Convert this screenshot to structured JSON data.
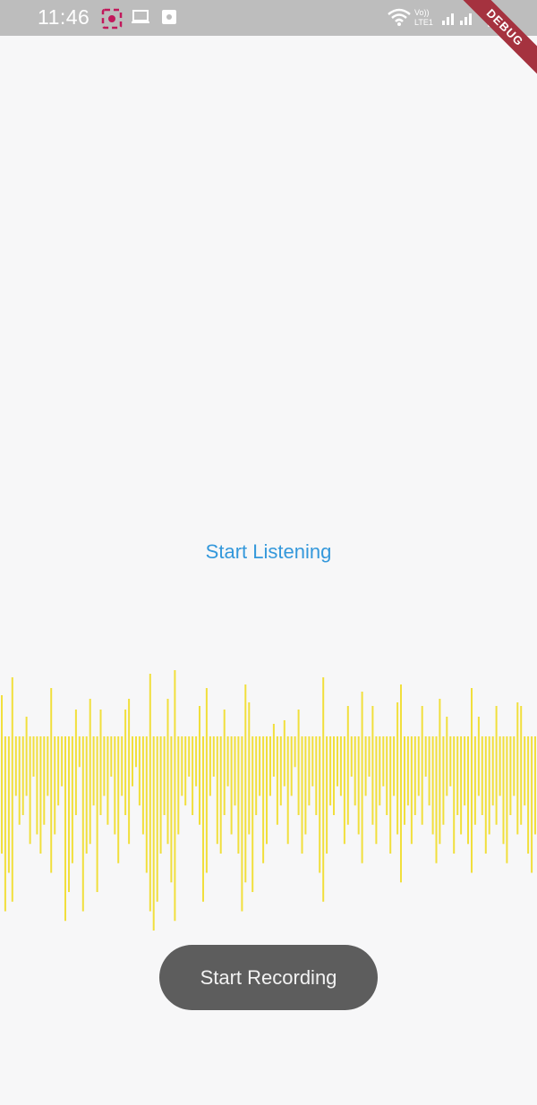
{
  "status_bar": {
    "time": "11:46",
    "network_label": "Vo)) LTE1",
    "icons": [
      "screenshot-icon",
      "laptop-icon",
      "media-icon",
      "wifi-icon",
      "signal-icon",
      "battery-icon"
    ]
  },
  "debug_banner": {
    "label": "DEBUG"
  },
  "main": {
    "listen_label": "Start Listening",
    "waveform_color": "#f1df3c",
    "waveform_levels": [
      0.6,
      0.9,
      0.7,
      0.85,
      0.3,
      0.45,
      0.4,
      0.3,
      0.55,
      0.2,
      0.5,
      0.6,
      0.45,
      0.3,
      0.7,
      0.5,
      0.35,
      0.25,
      0.95,
      0.8,
      0.65,
      0.4,
      0.15,
      0.9,
      0.6,
      0.55,
      0.35,
      0.8,
      0.4,
      0.3,
      0.45,
      0.2,
      0.5,
      0.65,
      0.3,
      0.4,
      0.55,
      0.25,
      0.15,
      0.35,
      0.5,
      0.7,
      0.9,
      1.0,
      0.85,
      0.6,
      0.4,
      0.55,
      0.75,
      0.95,
      0.5,
      0.3,
      0.35,
      0.2,
      0.4,
      0.25,
      0.45,
      0.85,
      0.7,
      0.3,
      0.2,
      0.55,
      0.6,
      0.4,
      0.25,
      0.5,
      0.35,
      0.6,
      0.9,
      0.75,
      0.5,
      0.8,
      0.4,
      0.3,
      0.65,
      0.55,
      0.3,
      0.2,
      0.45,
      0.35,
      0.25,
      0.55,
      0.3,
      0.15,
      0.4,
      0.6,
      0.5,
      0.35,
      0.25,
      0.4,
      0.7,
      0.85,
      0.6,
      0.35,
      0.4,
      0.25,
      0.3,
      0.55,
      0.45,
      0.2,
      0.35,
      0.5,
      0.65,
      0.3,
      0.2,
      0.45,
      0.55,
      0.35,
      0.25,
      0.4,
      0.6,
      0.3,
      0.5,
      0.75,
      0.45,
      0.35,
      0.55,
      0.4,
      0.3,
      0.45,
      0.2,
      0.35,
      0.5,
      0.65,
      0.55,
      0.45,
      0.3,
      0.25,
      0.6,
      0.4,
      0.5,
      0.35,
      0.55,
      0.7,
      0.45,
      0.3,
      0.4,
      0.6,
      0.5,
      0.35,
      0.45,
      0.3,
      0.55,
      0.65,
      0.4,
      0.3,
      0.5,
      0.45,
      0.35,
      0.6,
      0.7,
      0.5
    ],
    "record_button_label": "Start Recording"
  }
}
